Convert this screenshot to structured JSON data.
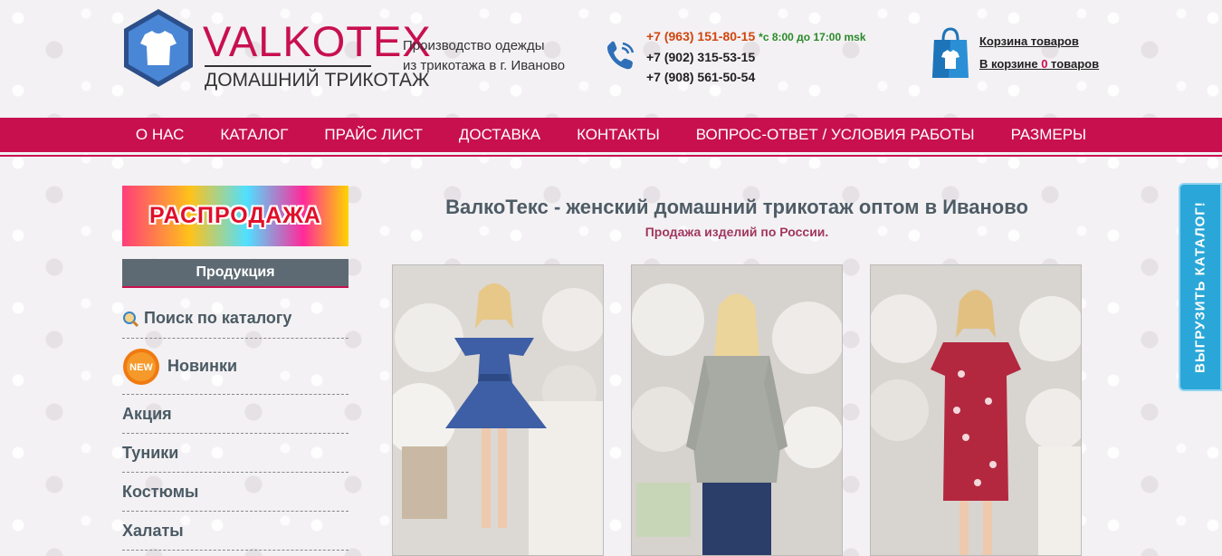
{
  "header": {
    "brand": "VALKOTEX",
    "sub_brand": "ДОМАШНИЙ ТРИКОТАЖ",
    "tagline_line1": "Производство одежды",
    "tagline_line2": "из трикотажа в г. Иваново",
    "phone1": "+7 (963) 151-80-15",
    "hours": "*с 8:00 до 17:00 msk",
    "phone2": "+7 (902) 315-53-15",
    "phone3": "+7 (908) 561-50-54",
    "cart_title": "Корзина товаров",
    "cart_prefix": "В корзине ",
    "cart_count": "0",
    "cart_suffix": " товаров"
  },
  "nav": [
    "О НАС",
    "КАТАЛОГ",
    "ПРАЙС ЛИСТ",
    "ДОСТАВКА",
    "КОНТАКТЫ",
    "ВОПРОС-ОТВЕТ / УСЛОВИЯ РАБОТЫ",
    "РАЗМЕРЫ"
  ],
  "sidebar": {
    "sale_banner": "РАСПРОДАЖА",
    "products_heading": "Продукция",
    "search_label": "Поиск по каталогу",
    "new_badge": "NEW",
    "items": [
      "Новинки",
      "Акция",
      "Туники",
      "Костюмы",
      "Халаты"
    ]
  },
  "main": {
    "title": "ВалкоТекс - женский домашний трикотаж оптом в Иваново",
    "subtitle": "Продажа изделий по России."
  },
  "export_tab": "ВЫГРУЗИТЬ КАТАЛОГ!",
  "colors": {
    "accent": "#c8104f",
    "nav_text": "#ffffff",
    "side_text": "#4a5a64",
    "export_tab": "#2aa7d8"
  }
}
